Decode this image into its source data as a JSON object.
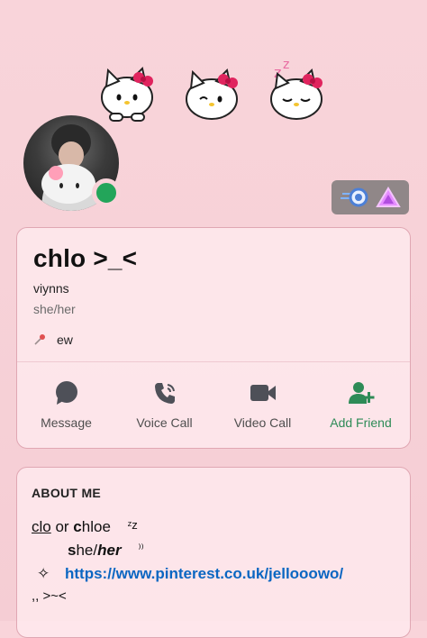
{
  "profile": {
    "display_name": "chlo >_<",
    "username": "viynns",
    "pronouns": "she/her",
    "custom_status": {
      "emoji": "pin-icon",
      "text": "ew"
    },
    "status_color": "#23a55a"
  },
  "actions": [
    {
      "label": "Message",
      "icon": "chat-bubble-icon"
    },
    {
      "label": "Voice Call",
      "icon": "phone-icon"
    },
    {
      "label": "Video Call",
      "icon": "video-camera-icon"
    },
    {
      "label": "Add Friend",
      "icon": "add-friend-icon",
      "color": "#2e8b57"
    }
  ],
  "about": {
    "title": "ABOUT ME",
    "line1_a": "clo",
    "line1_b": " or ",
    "line1_c": "c",
    "line1_d": "hloe",
    "line1_zz": "ᶻz",
    "line2_a": "s",
    "line2_b": "he/",
    "line2_c": "her",
    "line2_paren": "⁾⁾",
    "line3_star": "✧",
    "line3_link": "https://www.pinterest.co.uk/jellooowo/",
    "line4": ",, >~<"
  },
  "badges": [
    "nitro-boost-icon",
    "triangle-badge-icon"
  ],
  "colors": {
    "background": "#f8d3d9",
    "card_border": "#e0a7b3",
    "link": "#0a66c2",
    "add_friend": "#2e8b57"
  }
}
